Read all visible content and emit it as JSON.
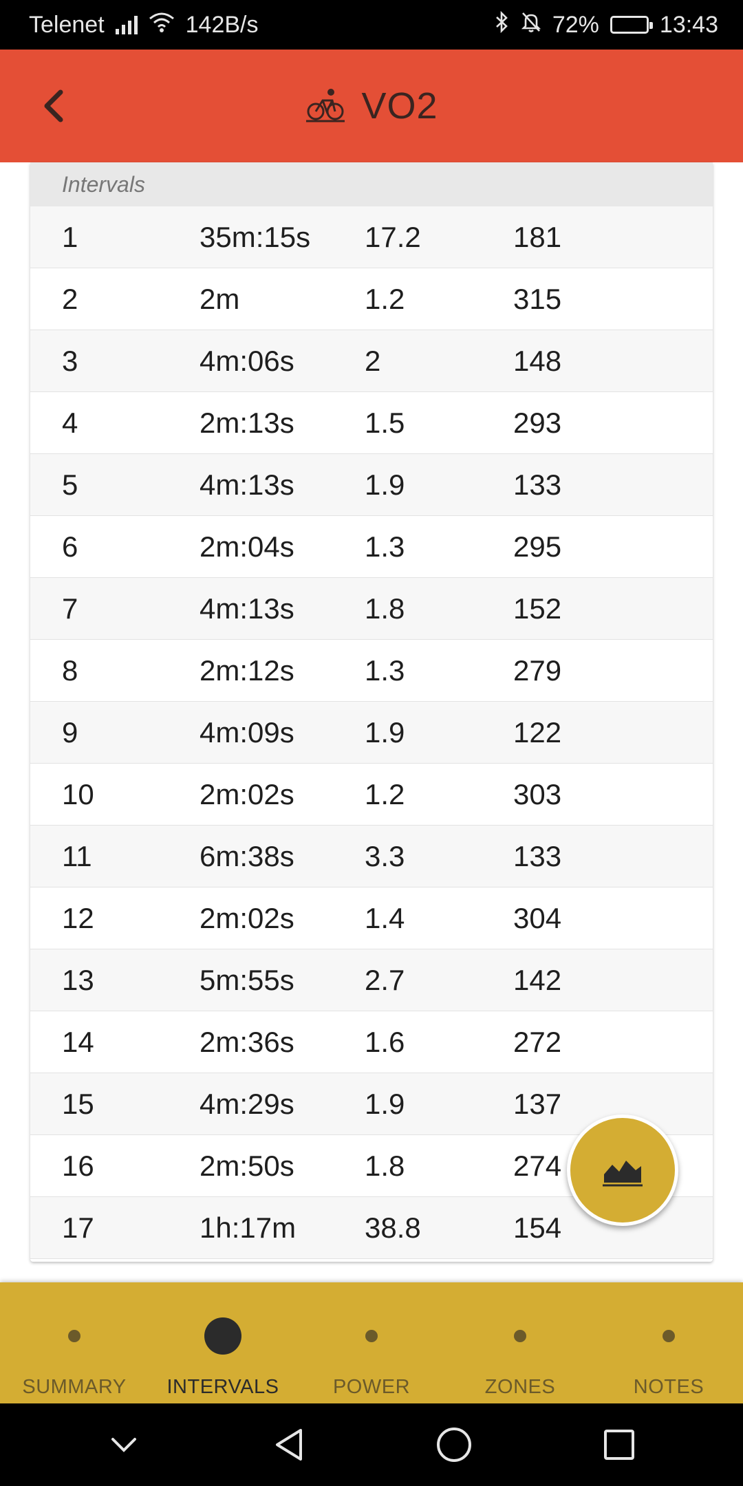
{
  "status_bar": {
    "carrier": "Telenet",
    "speed": "142B/s",
    "battery": "72%",
    "battery_level": 0.72,
    "time": "13:43"
  },
  "app_bar": {
    "title": "VO2",
    "back_icon": "chevron-left-icon",
    "title_icon": "bicycle-icon",
    "color": "#e44f36"
  },
  "table": {
    "header": "Intervals",
    "rows": [
      [
        "1",
        "35m:15s",
        "17.2",
        "181"
      ],
      [
        "2",
        "2m",
        "1.2",
        "315"
      ],
      [
        "3",
        "4m:06s",
        "2",
        "148"
      ],
      [
        "4",
        "2m:13s",
        "1.5",
        "293"
      ],
      [
        "5",
        "4m:13s",
        "1.9",
        "133"
      ],
      [
        "6",
        "2m:04s",
        "1.3",
        "295"
      ],
      [
        "7",
        "4m:13s",
        "1.8",
        "152"
      ],
      [
        "8",
        "2m:12s",
        "1.3",
        "279"
      ],
      [
        "9",
        "4m:09s",
        "1.9",
        "122"
      ],
      [
        "10",
        "2m:02s",
        "1.2",
        "303"
      ],
      [
        "11",
        "6m:38s",
        "3.3",
        "133"
      ],
      [
        "12",
        "2m:02s",
        "1.4",
        "304"
      ],
      [
        "13",
        "5m:55s",
        "2.7",
        "142"
      ],
      [
        "14",
        "2m:36s",
        "1.6",
        "272"
      ],
      [
        "15",
        "4m:29s",
        "1.9",
        "137"
      ],
      [
        "16",
        "2m:50s",
        "1.8",
        "274"
      ],
      [
        "17",
        "1h:17m",
        "38.8",
        "154"
      ]
    ]
  },
  "fab": {
    "icon": "area-chart-icon",
    "color": "#d4ad33"
  },
  "bottom_nav": {
    "color": "#d4ad33",
    "items": [
      {
        "label": "SUMMARY",
        "active": false
      },
      {
        "label": "INTERVALS",
        "active": true
      },
      {
        "label": "POWER",
        "active": false
      },
      {
        "label": "ZONES",
        "active": false
      },
      {
        "label": "NOTES",
        "active": false
      }
    ]
  },
  "system_nav": {
    "icons": [
      "chevron-down-icon",
      "back-triangle-icon",
      "home-circle-icon",
      "recents-square-icon"
    ]
  }
}
